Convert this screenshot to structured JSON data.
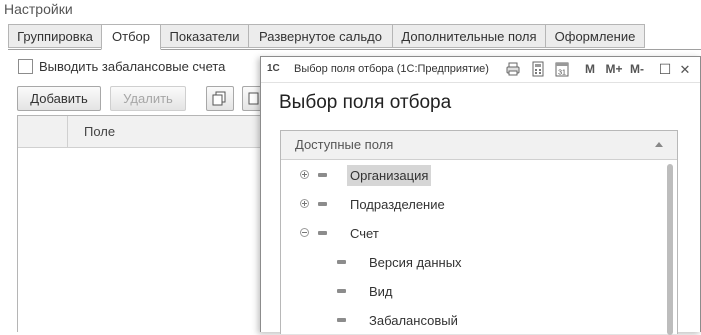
{
  "settings": {
    "title": "Настройки",
    "tabs": [
      "Группировка",
      "Отбор",
      "Показатели",
      "Развернутое сальдо",
      "Дополнительные поля",
      "Оформление"
    ],
    "active_tab": "Отбор",
    "offbalance_checkbox_label": "Выводить забалансовые счета",
    "offbalance_checked": false,
    "add_button": "Добавить",
    "delete_button": "Удалить",
    "grid_column": "Поле"
  },
  "dialog": {
    "app_logo": "1С",
    "window_title": "Выбор поля отбора  (1С:Предприятие)",
    "toolbar": {
      "m_label": "M",
      "mplus_label": "M+",
      "mminus_label": "M-",
      "calendar_day": "31",
      "maximize_glyph": "☐",
      "close_glyph": "✕"
    },
    "form_title": "Выбор поля отбора",
    "tree_header": "Доступные поля",
    "tree_items": [
      {
        "label": "Организация",
        "expander": "plus",
        "selected": true
      },
      {
        "label": "Подразделение",
        "expander": "plus",
        "selected": false
      },
      {
        "label": "Счет",
        "expander": "minus",
        "selected": false
      },
      {
        "label": "Версия данных",
        "expander": "none",
        "selected": false
      },
      {
        "label": "Вид",
        "expander": "none",
        "selected": false
      },
      {
        "label": "Забалансовый",
        "expander": "none",
        "selected": false
      }
    ]
  },
  "colors": {
    "selection": "#d6d6d6",
    "border": "#8c8c8c"
  }
}
